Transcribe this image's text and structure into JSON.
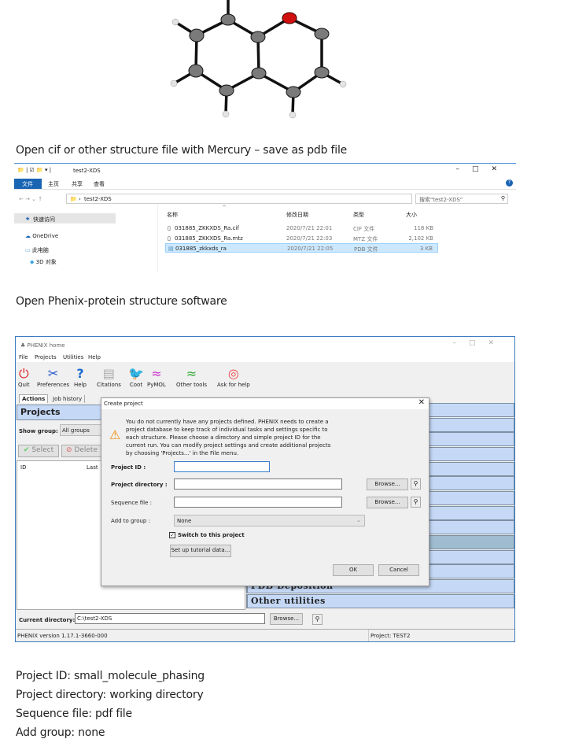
{
  "instructions": {
    "step1": "Open cif or other structure file with Mercury – save as pdb file",
    "step2": "Open Phenix-protein structure software",
    "notes": [
      "Project ID: small_molecule_phasing",
      "Project directory: working directory",
      "Sequence file: pdf file",
      "Add group: none"
    ]
  },
  "colors": {
    "oxygen": "#d01010",
    "carbon": "#777777",
    "hydrogen": "#dddddd",
    "explorer_accent": "#1a64b4",
    "phenix_stripe": "#c5d9f7"
  },
  "explorer": {
    "title": "test2-XDS",
    "ribbon_tabs": [
      "文件",
      "主页",
      "共享",
      "查看"
    ],
    "path": "test2-XDS",
    "search_placeholder": "搜索\"test2-XDS\"",
    "nav": [
      "快速访问",
      "OneDrive",
      "此电脑",
      "3D 对象"
    ],
    "columns": [
      "名称",
      "修改日期",
      "类型",
      "大小"
    ],
    "files": [
      {
        "name": "031885_ZKKXDS_Ra.cif",
        "date": "2020/7/21 22:01",
        "type": "CIF 文件",
        "size": "118 KB"
      },
      {
        "name": "031885_ZKKXDS_Ra.mtz",
        "date": "2020/7/21 22:03",
        "type": "MTZ 文件",
        "size": "2,102 KB"
      },
      {
        "name": "031885_zkkxds_ra",
        "date": "2020/7/21 22:05",
        "type": "PDB 文件",
        "size": "3 KB",
        "selected": true
      }
    ]
  },
  "phenix": {
    "title": "PHENIX home",
    "menu": [
      "File",
      "Projects",
      "Utilities",
      "Help"
    ],
    "toolbar": [
      "Quit",
      "Preferences",
      "Help",
      "Citations",
      "Coot",
      "PyMOL",
      "Other tools",
      "Ask for help"
    ],
    "tabs": [
      "Actions",
      "Job history"
    ],
    "projects_heading": "Projects",
    "show_group_label": "Show group:",
    "show_group_value": "All groups",
    "select_label": "Select",
    "delete_label": "Delete",
    "list_columns": [
      "ID",
      "Last"
    ],
    "right_items": [
      "PDB Deposition",
      "Other utilities"
    ],
    "current_dir_label": "Current directory:",
    "current_dir_value": "C:\\test2-XDS",
    "browse_label": "Browse...",
    "version": "PHENIX version 1.17.1-3660-000",
    "project": "Project: TEST2",
    "dialog": {
      "title": "Create project",
      "message": [
        "You do not currently have any projects defined.  PHENIX needs to create a",
        "project database to keep track of individual tasks and settings specific to",
        "each structure.  Please choose a directory and simple project ID for the",
        "current run.  You can modify project settings and create additional projects",
        "by choosing 'Projects...' in the File menu."
      ],
      "project_id_label": "Project ID :",
      "project_id_value": "",
      "project_dir_label": "Project directory :",
      "sequence_label": "Sequence file :",
      "group_label": "Add to group :",
      "group_value": "None",
      "switch_label": "Switch to this project",
      "switch_checked": true,
      "tutorial_label": "Set up tutorial data...",
      "ok_label": "OK",
      "cancel_label": "Cancel",
      "browse_label": "Browse..."
    }
  }
}
